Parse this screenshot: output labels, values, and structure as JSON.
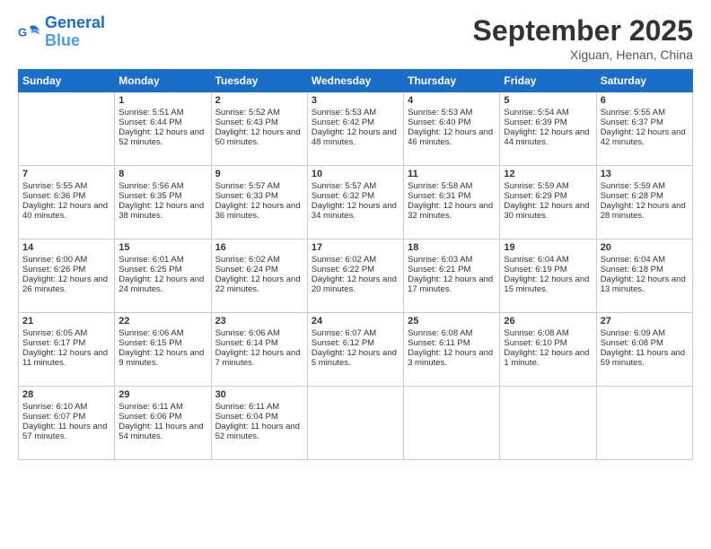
{
  "header": {
    "logo_line1": "General",
    "logo_line2": "Blue",
    "month_title": "September 2025",
    "location": "Xiguan, Henan, China"
  },
  "weekdays": [
    "Sunday",
    "Monday",
    "Tuesday",
    "Wednesday",
    "Thursday",
    "Friday",
    "Saturday"
  ],
  "weeks": [
    [
      {
        "day": "",
        "empty": true
      },
      {
        "day": "1",
        "sunrise": "5:51 AM",
        "sunset": "6:44 PM",
        "daylight": "12 hours and 52 minutes."
      },
      {
        "day": "2",
        "sunrise": "5:52 AM",
        "sunset": "6:43 PM",
        "daylight": "12 hours and 50 minutes."
      },
      {
        "day": "3",
        "sunrise": "5:53 AM",
        "sunset": "6:42 PM",
        "daylight": "12 hours and 48 minutes."
      },
      {
        "day": "4",
        "sunrise": "5:53 AM",
        "sunset": "6:40 PM",
        "daylight": "12 hours and 46 minutes."
      },
      {
        "day": "5",
        "sunrise": "5:54 AM",
        "sunset": "6:39 PM",
        "daylight": "12 hours and 44 minutes."
      },
      {
        "day": "6",
        "sunrise": "5:55 AM",
        "sunset": "6:37 PM",
        "daylight": "12 hours and 42 minutes."
      }
    ],
    [
      {
        "day": "7",
        "sunrise": "5:55 AM",
        "sunset": "6:36 PM",
        "daylight": "12 hours and 40 minutes."
      },
      {
        "day": "8",
        "sunrise": "5:56 AM",
        "sunset": "6:35 PM",
        "daylight": "12 hours and 38 minutes."
      },
      {
        "day": "9",
        "sunrise": "5:57 AM",
        "sunset": "6:33 PM",
        "daylight": "12 hours and 36 minutes."
      },
      {
        "day": "10",
        "sunrise": "5:57 AM",
        "sunset": "6:32 PM",
        "daylight": "12 hours and 34 minutes."
      },
      {
        "day": "11",
        "sunrise": "5:58 AM",
        "sunset": "6:31 PM",
        "daylight": "12 hours and 32 minutes."
      },
      {
        "day": "12",
        "sunrise": "5:59 AM",
        "sunset": "6:29 PM",
        "daylight": "12 hours and 30 minutes."
      },
      {
        "day": "13",
        "sunrise": "5:59 AM",
        "sunset": "6:28 PM",
        "daylight": "12 hours and 28 minutes."
      }
    ],
    [
      {
        "day": "14",
        "sunrise": "6:00 AM",
        "sunset": "6:26 PM",
        "daylight": "12 hours and 26 minutes."
      },
      {
        "day": "15",
        "sunrise": "6:01 AM",
        "sunset": "6:25 PM",
        "daylight": "12 hours and 24 minutes."
      },
      {
        "day": "16",
        "sunrise": "6:02 AM",
        "sunset": "6:24 PM",
        "daylight": "12 hours and 22 minutes."
      },
      {
        "day": "17",
        "sunrise": "6:02 AM",
        "sunset": "6:22 PM",
        "daylight": "12 hours and 20 minutes."
      },
      {
        "day": "18",
        "sunrise": "6:03 AM",
        "sunset": "6:21 PM",
        "daylight": "12 hours and 17 minutes."
      },
      {
        "day": "19",
        "sunrise": "6:04 AM",
        "sunset": "6:19 PM",
        "daylight": "12 hours and 15 minutes."
      },
      {
        "day": "20",
        "sunrise": "6:04 AM",
        "sunset": "6:18 PM",
        "daylight": "12 hours and 13 minutes."
      }
    ],
    [
      {
        "day": "21",
        "sunrise": "6:05 AM",
        "sunset": "6:17 PM",
        "daylight": "12 hours and 11 minutes."
      },
      {
        "day": "22",
        "sunrise": "6:06 AM",
        "sunset": "6:15 PM",
        "daylight": "12 hours and 9 minutes."
      },
      {
        "day": "23",
        "sunrise": "6:06 AM",
        "sunset": "6:14 PM",
        "daylight": "12 hours and 7 minutes."
      },
      {
        "day": "24",
        "sunrise": "6:07 AM",
        "sunset": "6:12 PM",
        "daylight": "12 hours and 5 minutes."
      },
      {
        "day": "25",
        "sunrise": "6:08 AM",
        "sunset": "6:11 PM",
        "daylight": "12 hours and 3 minutes."
      },
      {
        "day": "26",
        "sunrise": "6:08 AM",
        "sunset": "6:10 PM",
        "daylight": "12 hours and 1 minute."
      },
      {
        "day": "27",
        "sunrise": "6:09 AM",
        "sunset": "6:08 PM",
        "daylight": "11 hours and 59 minutes."
      }
    ],
    [
      {
        "day": "28",
        "sunrise": "6:10 AM",
        "sunset": "6:07 PM",
        "daylight": "11 hours and 57 minutes."
      },
      {
        "day": "29",
        "sunrise": "6:11 AM",
        "sunset": "6:06 PM",
        "daylight": "11 hours and 54 minutes."
      },
      {
        "day": "30",
        "sunrise": "6:11 AM",
        "sunset": "6:04 PM",
        "daylight": "11 hours and 52 minutes."
      },
      {
        "day": "",
        "empty": true
      },
      {
        "day": "",
        "empty": true
      },
      {
        "day": "",
        "empty": true
      },
      {
        "day": "",
        "empty": true
      }
    ]
  ]
}
